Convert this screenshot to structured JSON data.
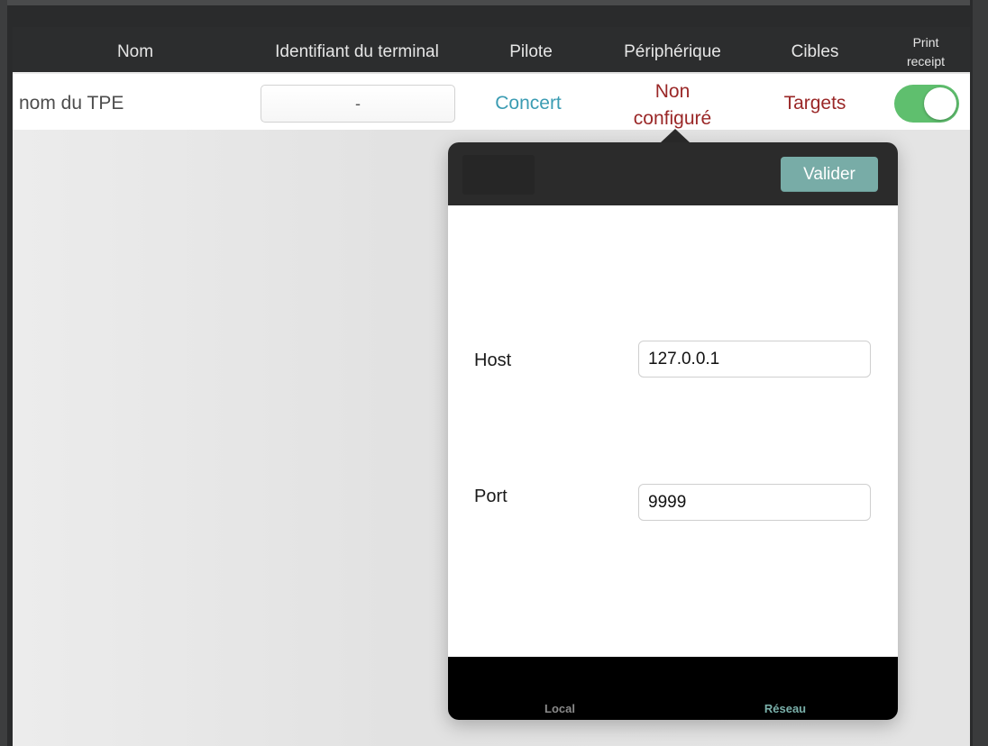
{
  "table": {
    "columns": {
      "name": "Nom",
      "terminal_id": "Identifiant du terminal",
      "pilot": "Pilote",
      "device": "Périphérique",
      "targets": "Cibles",
      "print_receipt_line1": "Print",
      "print_receipt_line2": "receipt"
    },
    "row": {
      "name": "nom du TPE",
      "terminal_id": "-",
      "pilot": "Concert",
      "device_line1": "Non",
      "device_line2": "configuré",
      "targets": "Targets",
      "print_receipt": true
    }
  },
  "popover": {
    "validate_label": "Valider",
    "fields": {
      "host_label": "Host",
      "host_value": "127.0.0.1",
      "port_label": "Port",
      "port_value": "9999"
    },
    "tabs": {
      "local": "Local",
      "network": "Réseau",
      "selected": "network"
    }
  },
  "colors": {
    "pilot_link": "#3b9cb3",
    "alert_link": "#9a2727",
    "toggle_on": "#5fbf6e",
    "validate_button": "#78aca7",
    "selected_tab": "#7ab0aa"
  }
}
